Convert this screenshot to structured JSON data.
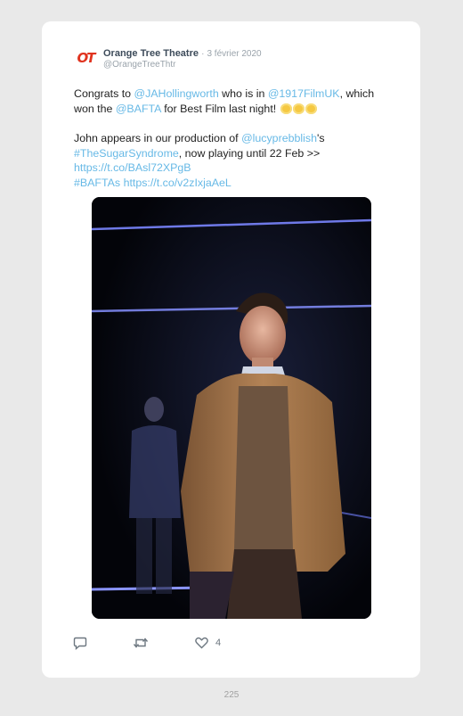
{
  "author": {
    "avatar_text": "OT",
    "name": "Orange Tree Theatre",
    "separator": "·",
    "date": "3 février 2020",
    "handle": "@OrangeTreeThtr"
  },
  "tweet": {
    "p1": {
      "t1": "Congrats to ",
      "m1": "@JAHollingworth",
      "t2": " who is in ",
      "m2": "@1917FilmUK",
      "t3": ", which won the ",
      "m3": "@BAFTA",
      "t4": " for Best Film last night! "
    },
    "p2": {
      "t1": "John appears in our production of ",
      "m1": "@lucyprebblish",
      "t2": "'s ",
      "h1": "#TheSugarSyndrome",
      "t3": ", now playing until 22 Feb >> ",
      "l1": "https://t.co/BAsl72XPgB",
      "h2": "#BAFTAs",
      "l2": "https://t.co/v2zIxjaAeL"
    },
    "emoji": "clapping-hands"
  },
  "actions": {
    "reply_icon": "speech-bubble-icon",
    "retweet_icon": "retweet-icon",
    "like_icon": "heart-icon",
    "like_count": "4"
  },
  "page_number": "225",
  "colors": {
    "link": "#67b9e6",
    "brand": "#e0331f",
    "background": "#e9e9e9"
  }
}
